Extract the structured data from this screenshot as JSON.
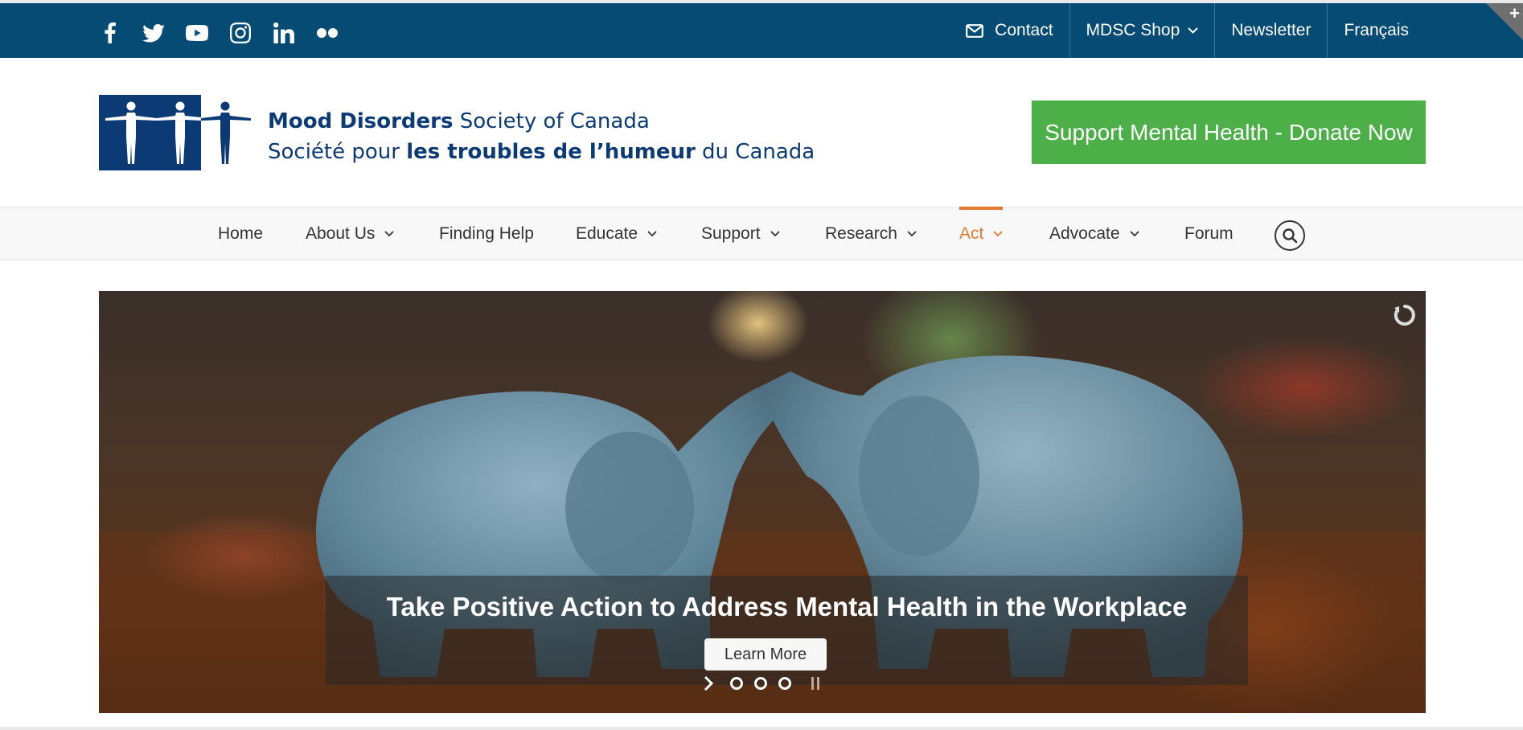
{
  "social": {
    "icons": [
      "facebook-icon",
      "twitter-icon",
      "youtube-icon",
      "instagram-icon",
      "linkedin-icon",
      "flickr-icon"
    ]
  },
  "top_links": {
    "contact": "Contact",
    "shop": "MDSC Shop",
    "newsletter": "Newsletter",
    "language": "Français"
  },
  "corner_toggle": "+",
  "logo": {
    "line1_bold": "Mood Disorders",
    "line1_rest": " Society of Canada",
    "line2_start": "Société pour ",
    "line2_bold": "les troubles de l’humeur",
    "line2_end": " du Canada"
  },
  "donate_button": "Support Mental Health - Donate Now",
  "nav": {
    "items": [
      {
        "label": "Home",
        "dropdown": false
      },
      {
        "label": "About Us",
        "dropdown": true
      },
      {
        "label": "Finding Help",
        "dropdown": false
      },
      {
        "label": "Educate",
        "dropdown": true
      },
      {
        "label": "Support",
        "dropdown": true
      },
      {
        "label": "Research",
        "dropdown": true
      },
      {
        "label": "Act",
        "dropdown": true,
        "active": true
      },
      {
        "label": "Advocate",
        "dropdown": true
      },
      {
        "label": "Forum",
        "dropdown": false
      }
    ],
    "active_color": "#e2792e"
  },
  "hero": {
    "title": "Take Positive Action to Address Mental Health in the Workplace",
    "button": "Learn More",
    "slide_count": 3
  },
  "colors": {
    "topbar": "#054b73",
    "donate": "#4caf48",
    "logo_blue": "#0b3a75"
  }
}
